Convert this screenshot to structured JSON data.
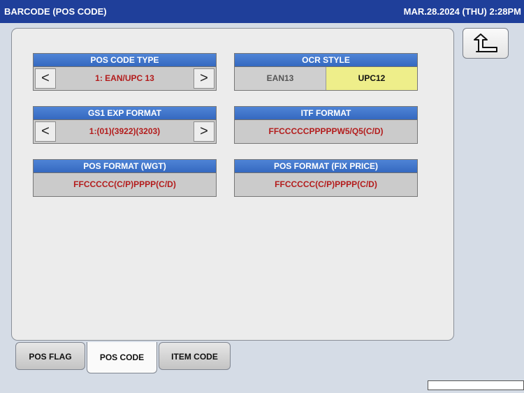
{
  "window": {
    "title": "BARCODE (POS CODE)",
    "datetime": "MAR.28.2024 (THU)  2:28PM"
  },
  "back_icon": "return-arrow-icon",
  "groups": {
    "pos_code_type": {
      "label": "POS CODE TYPE",
      "value": "1: EAN/UPC 13",
      "prev": "<",
      "next": ">"
    },
    "ocr_style": {
      "label": "OCR STYLE",
      "options": [
        "EAN13",
        "UPC12"
      ],
      "selected": "UPC12"
    },
    "gs1_exp_format": {
      "label": "GS1 EXP FORMAT",
      "value": "1:(01)(3922)(3203)",
      "prev": "<",
      "next": ">"
    },
    "itf_format": {
      "label": "ITF FORMAT",
      "value": "FFCCCCCPPPPPW5/Q5(C/D)"
    },
    "pos_format_wgt": {
      "label": "POS FORMAT (WGT)",
      "value": "FFCCCCC(C/P)PPPP(C/D)"
    },
    "pos_format_fix_price": {
      "label": "POS FORMAT (FIX PRICE)",
      "value": "FFCCCCC(C/P)PPPP(C/D)"
    }
  },
  "tabs": [
    {
      "label": "POS FLAG",
      "active": false
    },
    {
      "label": "POS CODE",
      "active": true
    },
    {
      "label": "ITEM CODE",
      "active": false
    }
  ],
  "colors": {
    "title_bar": "#1f3f9a",
    "group_header": "#3f74cc",
    "value_text": "#b31c1c",
    "selected_option": "#eeee8a"
  }
}
